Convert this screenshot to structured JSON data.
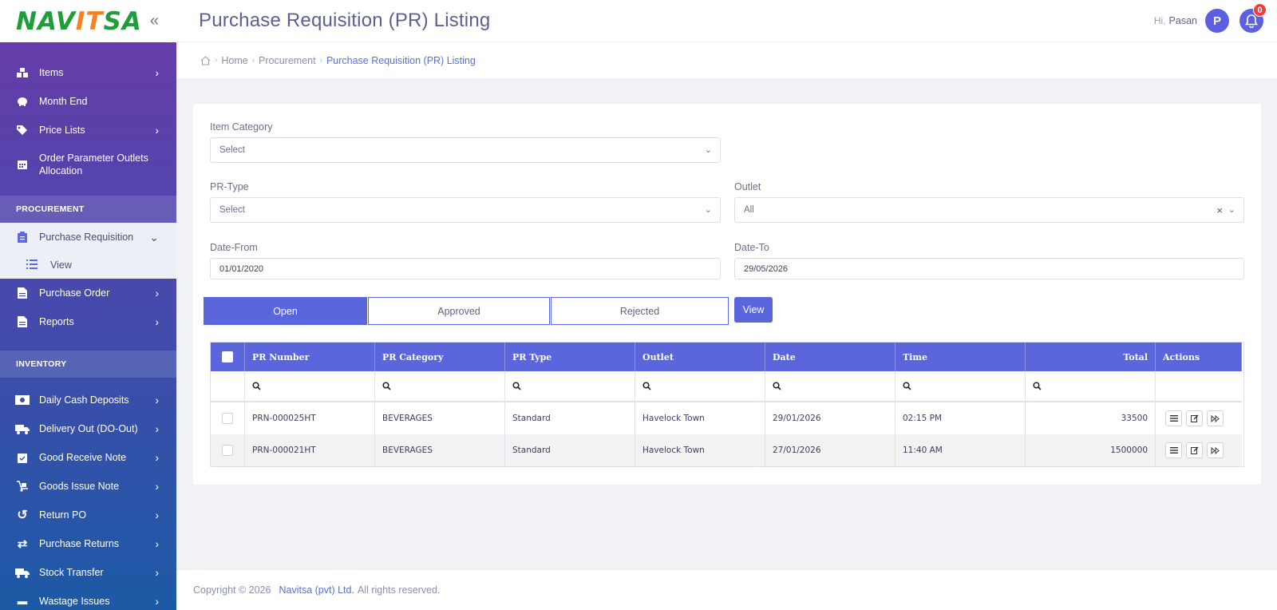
{
  "logo": {
    "text_a": "NAV",
    "text_accent": "IT",
    "text_b": "SA"
  },
  "header": {
    "title": "Purchase Requisition (PR) Listing",
    "greeting": "Hi,",
    "user_name": "Pasan",
    "avatar_letter": "P",
    "notification_count": "0"
  },
  "breadcrumb": {
    "home": "Home",
    "section": "Procurement",
    "current": "Purchase Requisition (PR) Listing"
  },
  "sidebar": {
    "items_top": [
      {
        "label": "Items"
      },
      {
        "label": "Month End"
      },
      {
        "label": "Price Lists"
      },
      {
        "label": "Order Parameter Outlets Allocation"
      }
    ],
    "procurement_heading": "PROCUREMENT",
    "purchase_requisition": "Purchase Requisition",
    "pr_view": "View",
    "purchase_order": "Purchase Order",
    "reports": "Reports",
    "inventory_heading": "INVENTORY",
    "inventory_items": [
      {
        "label": "Daily Cash Deposits"
      },
      {
        "label": "Delivery Out (DO-Out)"
      },
      {
        "label": "Good Receive Note"
      },
      {
        "label": "Goods Issue Note"
      },
      {
        "label": "Return PO"
      },
      {
        "label": "Purchase Returns"
      },
      {
        "label": "Stock Transfer"
      },
      {
        "label": "Wastage Issues"
      }
    ]
  },
  "filters": {
    "item_category_label": "Item Category",
    "item_category_value": "Select",
    "pr_type_label": "PR-Type",
    "pr_type_value": "Select",
    "outlet_label": "Outlet",
    "outlet_value": "All",
    "date_from_label": "Date-From",
    "date_from_value": "01/01/2020",
    "date_to_label": "Date-To",
    "date_to_value": "29/05/2026"
  },
  "tabs": {
    "open": "Open",
    "approved": "Approved",
    "rejected": "Rejected",
    "view_button": "View"
  },
  "table": {
    "columns": [
      "PR Number",
      "PR Category",
      "PR Type",
      "Outlet",
      "Date",
      "Time",
      "Total",
      "Actions"
    ],
    "rows": [
      {
        "pr_number": "PRN-000025HT",
        "category": "BEVERAGES",
        "type": "Standard",
        "outlet": "Havelock Town",
        "date": "29/01/2026",
        "time": "02:15 PM",
        "total": "33500"
      },
      {
        "pr_number": "PRN-000021HT",
        "category": "BEVERAGES",
        "type": "Standard",
        "outlet": "Havelock Town",
        "date": "27/01/2026",
        "time": "11:40 AM",
        "total": "1500000"
      }
    ]
  },
  "footer": {
    "copyright": "Copyright © 2026",
    "company": "Navitsa (pvt) Ltd.",
    "rights": "All rights reserved."
  },
  "colors": {
    "primary": "#5b65dc",
    "logo_green": "#1f9d3a",
    "logo_orange": "#f58220",
    "badge_red": "#ef3d3d"
  }
}
